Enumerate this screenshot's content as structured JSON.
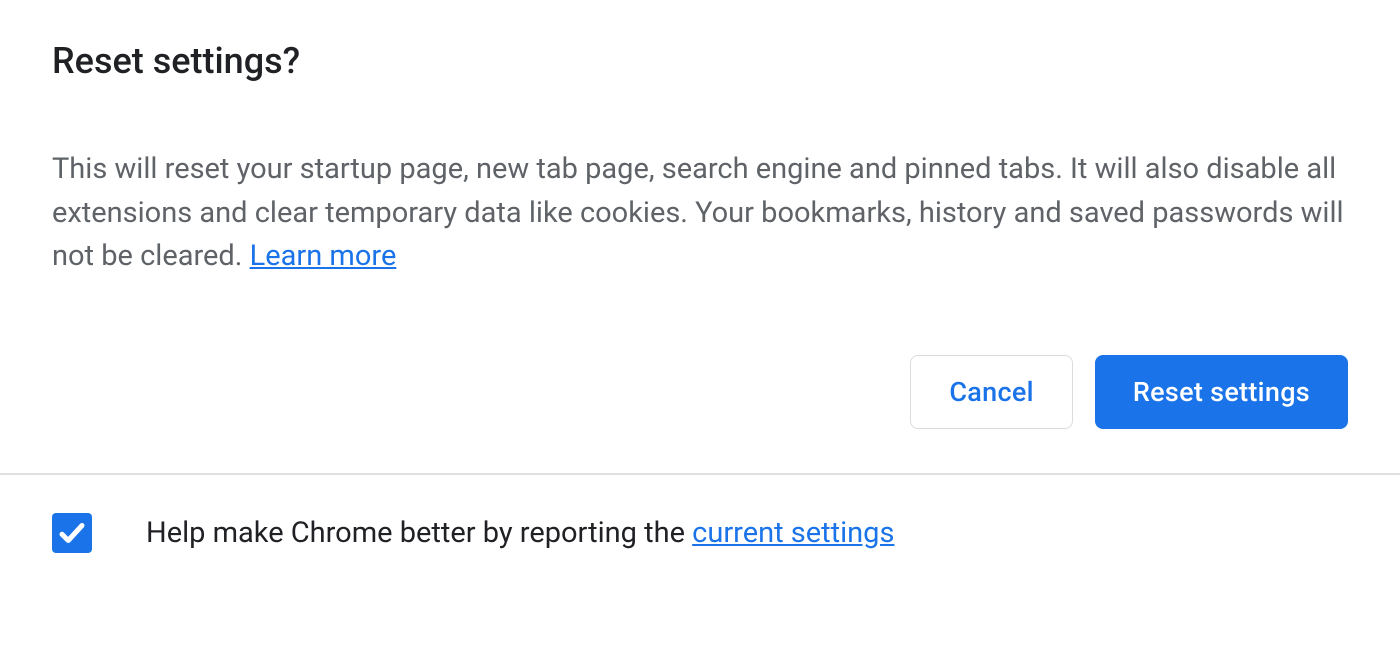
{
  "dialog": {
    "title": "Reset settings?",
    "description": "This will reset your startup page, new tab page, search engine and pinned tabs. It will also disable all extensions and clear temporary data like cookies. Your bookmarks, history and saved passwords will not be cleared. ",
    "learn_more": "Learn more",
    "cancel_label": "Cancel",
    "reset_label": "Reset settings"
  },
  "footer": {
    "report_text_prefix": "Help make Chrome better by reporting the ",
    "report_link": "current settings",
    "checkbox_checked": true
  },
  "colors": {
    "primary": "#1a73e8",
    "text": "#202124",
    "muted": "#5f6368",
    "border": "#dadce0"
  }
}
